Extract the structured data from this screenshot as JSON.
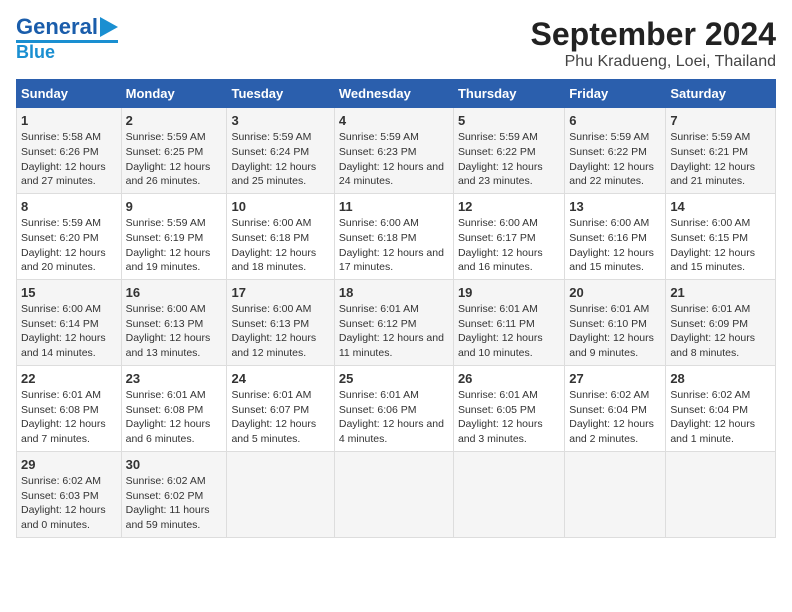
{
  "logo": {
    "line1": "General",
    "line2": "Blue"
  },
  "title": "September 2024",
  "subtitle": "Phu Kradueng, Loei, Thailand",
  "days_of_week": [
    "Sunday",
    "Monday",
    "Tuesday",
    "Wednesday",
    "Thursday",
    "Friday",
    "Saturday"
  ],
  "weeks": [
    [
      {
        "day": "1",
        "sunrise": "Sunrise: 5:58 AM",
        "sunset": "Sunset: 6:26 PM",
        "daylight": "Daylight: 12 hours and 27 minutes."
      },
      {
        "day": "2",
        "sunrise": "Sunrise: 5:59 AM",
        "sunset": "Sunset: 6:25 PM",
        "daylight": "Daylight: 12 hours and 26 minutes."
      },
      {
        "day": "3",
        "sunrise": "Sunrise: 5:59 AM",
        "sunset": "Sunset: 6:24 PM",
        "daylight": "Daylight: 12 hours and 25 minutes."
      },
      {
        "day": "4",
        "sunrise": "Sunrise: 5:59 AM",
        "sunset": "Sunset: 6:23 PM",
        "daylight": "Daylight: 12 hours and 24 minutes."
      },
      {
        "day": "5",
        "sunrise": "Sunrise: 5:59 AM",
        "sunset": "Sunset: 6:22 PM",
        "daylight": "Daylight: 12 hours and 23 minutes."
      },
      {
        "day": "6",
        "sunrise": "Sunrise: 5:59 AM",
        "sunset": "Sunset: 6:22 PM",
        "daylight": "Daylight: 12 hours and 22 minutes."
      },
      {
        "day": "7",
        "sunrise": "Sunrise: 5:59 AM",
        "sunset": "Sunset: 6:21 PM",
        "daylight": "Daylight: 12 hours and 21 minutes."
      }
    ],
    [
      {
        "day": "8",
        "sunrise": "Sunrise: 5:59 AM",
        "sunset": "Sunset: 6:20 PM",
        "daylight": "Daylight: 12 hours and 20 minutes."
      },
      {
        "day": "9",
        "sunrise": "Sunrise: 5:59 AM",
        "sunset": "Sunset: 6:19 PM",
        "daylight": "Daylight: 12 hours and 19 minutes."
      },
      {
        "day": "10",
        "sunrise": "Sunrise: 6:00 AM",
        "sunset": "Sunset: 6:18 PM",
        "daylight": "Daylight: 12 hours and 18 minutes."
      },
      {
        "day": "11",
        "sunrise": "Sunrise: 6:00 AM",
        "sunset": "Sunset: 6:18 PM",
        "daylight": "Daylight: 12 hours and 17 minutes."
      },
      {
        "day": "12",
        "sunrise": "Sunrise: 6:00 AM",
        "sunset": "Sunset: 6:17 PM",
        "daylight": "Daylight: 12 hours and 16 minutes."
      },
      {
        "day": "13",
        "sunrise": "Sunrise: 6:00 AM",
        "sunset": "Sunset: 6:16 PM",
        "daylight": "Daylight: 12 hours and 15 minutes."
      },
      {
        "day": "14",
        "sunrise": "Sunrise: 6:00 AM",
        "sunset": "Sunset: 6:15 PM",
        "daylight": "Daylight: 12 hours and 15 minutes."
      }
    ],
    [
      {
        "day": "15",
        "sunrise": "Sunrise: 6:00 AM",
        "sunset": "Sunset: 6:14 PM",
        "daylight": "Daylight: 12 hours and 14 minutes."
      },
      {
        "day": "16",
        "sunrise": "Sunrise: 6:00 AM",
        "sunset": "Sunset: 6:13 PM",
        "daylight": "Daylight: 12 hours and 13 minutes."
      },
      {
        "day": "17",
        "sunrise": "Sunrise: 6:00 AM",
        "sunset": "Sunset: 6:13 PM",
        "daylight": "Daylight: 12 hours and 12 minutes."
      },
      {
        "day": "18",
        "sunrise": "Sunrise: 6:01 AM",
        "sunset": "Sunset: 6:12 PM",
        "daylight": "Daylight: 12 hours and 11 minutes."
      },
      {
        "day": "19",
        "sunrise": "Sunrise: 6:01 AM",
        "sunset": "Sunset: 6:11 PM",
        "daylight": "Daylight: 12 hours and 10 minutes."
      },
      {
        "day": "20",
        "sunrise": "Sunrise: 6:01 AM",
        "sunset": "Sunset: 6:10 PM",
        "daylight": "Daylight: 12 hours and 9 minutes."
      },
      {
        "day": "21",
        "sunrise": "Sunrise: 6:01 AM",
        "sunset": "Sunset: 6:09 PM",
        "daylight": "Daylight: 12 hours and 8 minutes."
      }
    ],
    [
      {
        "day": "22",
        "sunrise": "Sunrise: 6:01 AM",
        "sunset": "Sunset: 6:08 PM",
        "daylight": "Daylight: 12 hours and 7 minutes."
      },
      {
        "day": "23",
        "sunrise": "Sunrise: 6:01 AM",
        "sunset": "Sunset: 6:08 PM",
        "daylight": "Daylight: 12 hours and 6 minutes."
      },
      {
        "day": "24",
        "sunrise": "Sunrise: 6:01 AM",
        "sunset": "Sunset: 6:07 PM",
        "daylight": "Daylight: 12 hours and 5 minutes."
      },
      {
        "day": "25",
        "sunrise": "Sunrise: 6:01 AM",
        "sunset": "Sunset: 6:06 PM",
        "daylight": "Daylight: 12 hours and 4 minutes."
      },
      {
        "day": "26",
        "sunrise": "Sunrise: 6:01 AM",
        "sunset": "Sunset: 6:05 PM",
        "daylight": "Daylight: 12 hours and 3 minutes."
      },
      {
        "day": "27",
        "sunrise": "Sunrise: 6:02 AM",
        "sunset": "Sunset: 6:04 PM",
        "daylight": "Daylight: 12 hours and 2 minutes."
      },
      {
        "day": "28",
        "sunrise": "Sunrise: 6:02 AM",
        "sunset": "Sunset: 6:04 PM",
        "daylight": "Daylight: 12 hours and 1 minute."
      }
    ],
    [
      {
        "day": "29",
        "sunrise": "Sunrise: 6:02 AM",
        "sunset": "Sunset: 6:03 PM",
        "daylight": "Daylight: 12 hours and 0 minutes."
      },
      {
        "day": "30",
        "sunrise": "Sunrise: 6:02 AM",
        "sunset": "Sunset: 6:02 PM",
        "daylight": "Daylight: 11 hours and 59 minutes."
      },
      null,
      null,
      null,
      null,
      null
    ]
  ]
}
